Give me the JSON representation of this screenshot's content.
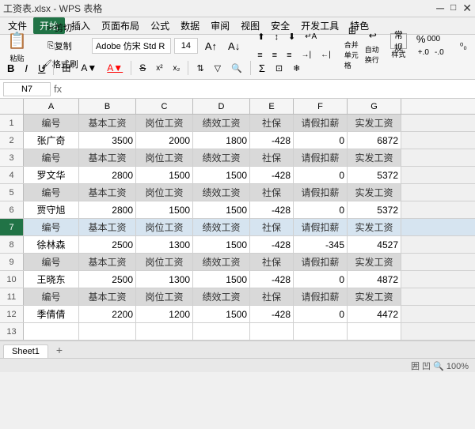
{
  "titlebar": {
    "filename": "工资表.xlsx - WPS 表格",
    "tabs": [
      "文件",
      "开始",
      "插入",
      "页面布局",
      "公式",
      "数据",
      "审阅",
      "视图",
      "安全",
      "开发工具",
      "特色"
    ]
  },
  "toolbar": {
    "paste_label": "粘贴",
    "cut_label": "剪切",
    "copy_label": "复制",
    "format_painter_label": "格式刷",
    "font_name": "Adobe 仿宋 Std R",
    "font_size": "14",
    "bold_label": "B",
    "italic_label": "I",
    "underline_label": "U",
    "border_label": "田",
    "merge_label": "合并单元格",
    "auto_row_label": "自动换行",
    "normal_label": "常规",
    "percent_label": "%",
    "thousand_label": "000",
    "inc_decimal": "+.0",
    "dec_decimal": "-.0"
  },
  "formula_bar": {
    "cell_ref": "N7",
    "formula_symbol": "fx",
    "value": ""
  },
  "columns": {
    "row_num": "",
    "headers": [
      "A",
      "B",
      "C",
      "D",
      "E",
      "F",
      "G"
    ]
  },
  "rows": [
    {
      "row": 1,
      "type": "header",
      "cells": [
        "编号",
        "基本工资",
        "岗位工资",
        "绩效工资",
        "社保",
        "请假扣薪",
        "实发工资"
      ]
    },
    {
      "row": 2,
      "type": "data",
      "cells": [
        "张广奇",
        "3500",
        "2000",
        "1800",
        "-428",
        "0",
        "6872"
      ]
    },
    {
      "row": 3,
      "type": "header",
      "cells": [
        "编号",
        "基本工资",
        "岗位工资",
        "绩效工资",
        "社保",
        "请假扣薪",
        "实发工资"
      ]
    },
    {
      "row": 4,
      "type": "data",
      "cells": [
        "罗文华",
        "2800",
        "1500",
        "1500",
        "-428",
        "0",
        "5372"
      ]
    },
    {
      "row": 5,
      "type": "header",
      "cells": [
        "编号",
        "基本工资",
        "岗位工资",
        "绩效工资",
        "社保",
        "请假扣薪",
        "实发工资"
      ]
    },
    {
      "row": 6,
      "type": "data",
      "cells": [
        "贾守旭",
        "2800",
        "1500",
        "1500",
        "-428",
        "0",
        "5372"
      ]
    },
    {
      "row": 7,
      "type": "header",
      "is_selected": true,
      "cells": [
        "编号",
        "基本工资",
        "岗位工资",
        "绩效工资",
        "社保",
        "请假扣薪",
        "实发工资"
      ]
    },
    {
      "row": 8,
      "type": "data",
      "cells": [
        "徐林森",
        "2500",
        "1300",
        "1500",
        "-428",
        "-345",
        "4527"
      ]
    },
    {
      "row": 9,
      "type": "header",
      "cells": [
        "编号",
        "基本工资",
        "岗位工资",
        "绩效工资",
        "社保",
        "请假扣薪",
        "实发工资"
      ]
    },
    {
      "row": 10,
      "type": "data",
      "cells": [
        "王晓东",
        "2500",
        "1300",
        "1500",
        "-428",
        "0",
        "4872"
      ]
    },
    {
      "row": 11,
      "type": "header",
      "cells": [
        "编号",
        "基本工资",
        "岗位工资",
        "绩效工资",
        "社保",
        "请假扣薪",
        "实发工资"
      ]
    },
    {
      "row": 12,
      "type": "data",
      "cells": [
        "季倩倩",
        "2200",
        "1200",
        "1500",
        "-428",
        "0",
        "4472"
      ]
    },
    {
      "row": 13,
      "type": "empty",
      "cells": [
        "",
        "",
        "",
        "",
        "",
        "",
        ""
      ]
    }
  ],
  "sheet_tabs": [
    "Sheet1"
  ],
  "status_bar": {
    "left": "",
    "right": "囲 凹 🔍 100%"
  }
}
